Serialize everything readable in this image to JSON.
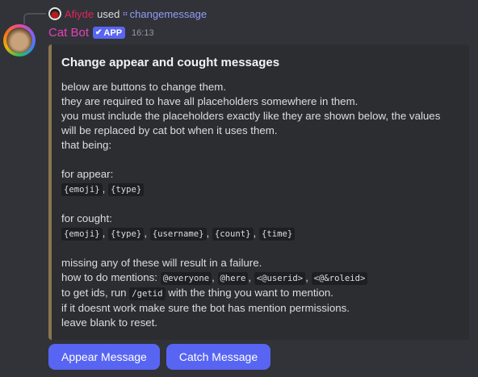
{
  "reply": {
    "username": "Afiyde",
    "used_text": "used",
    "command": "changemessage"
  },
  "message": {
    "author": "Cat Bot",
    "app_tag": "APP",
    "timestamp": "16:13"
  },
  "embed": {
    "title": "Change appear and cought messages",
    "intro": [
      "below are buttons to change them.",
      "they are required to have all placeholders somewhere in them.",
      "you must include the placeholders exactly like they are shown below, the values",
      "will be replaced by cat bot when it uses them.",
      "that being:"
    ],
    "appear_label": "for appear:",
    "appear_placeholders": [
      "{emoji}",
      "{type}"
    ],
    "cought_label": "for cought:",
    "cought_placeholders": [
      "{emoji}",
      "{type}",
      "{username}",
      "{count}",
      "{time}"
    ],
    "separator": ", ",
    "failure_line": "missing any of these will result in a failure.",
    "mentions_prefix": "how to do mentions: ",
    "mentions": [
      "@everyone",
      "@here",
      "<@userid>",
      "<@&roleid>"
    ],
    "ids_prefix": "to get ids, run ",
    "ids_command": "/getid",
    "ids_suffix": " with the thing you want to mention.",
    "perm_line": "if it doesnt work make sure the bot has mention permissions.",
    "reset_line": "leave blank to reset."
  },
  "buttons": {
    "appear": "Appear Message",
    "catch": "Catch Message"
  },
  "colors": {
    "background": "#313338",
    "embed_background": "#2b2d31",
    "embed_border": "#8a754f",
    "blurple": "#5865f2",
    "reply_username": "#e0245e",
    "author_name": "#e542b8",
    "command": "#949cf7"
  },
  "icons": {
    "command": "slash-command-icon",
    "verified": "checkmark-icon"
  }
}
